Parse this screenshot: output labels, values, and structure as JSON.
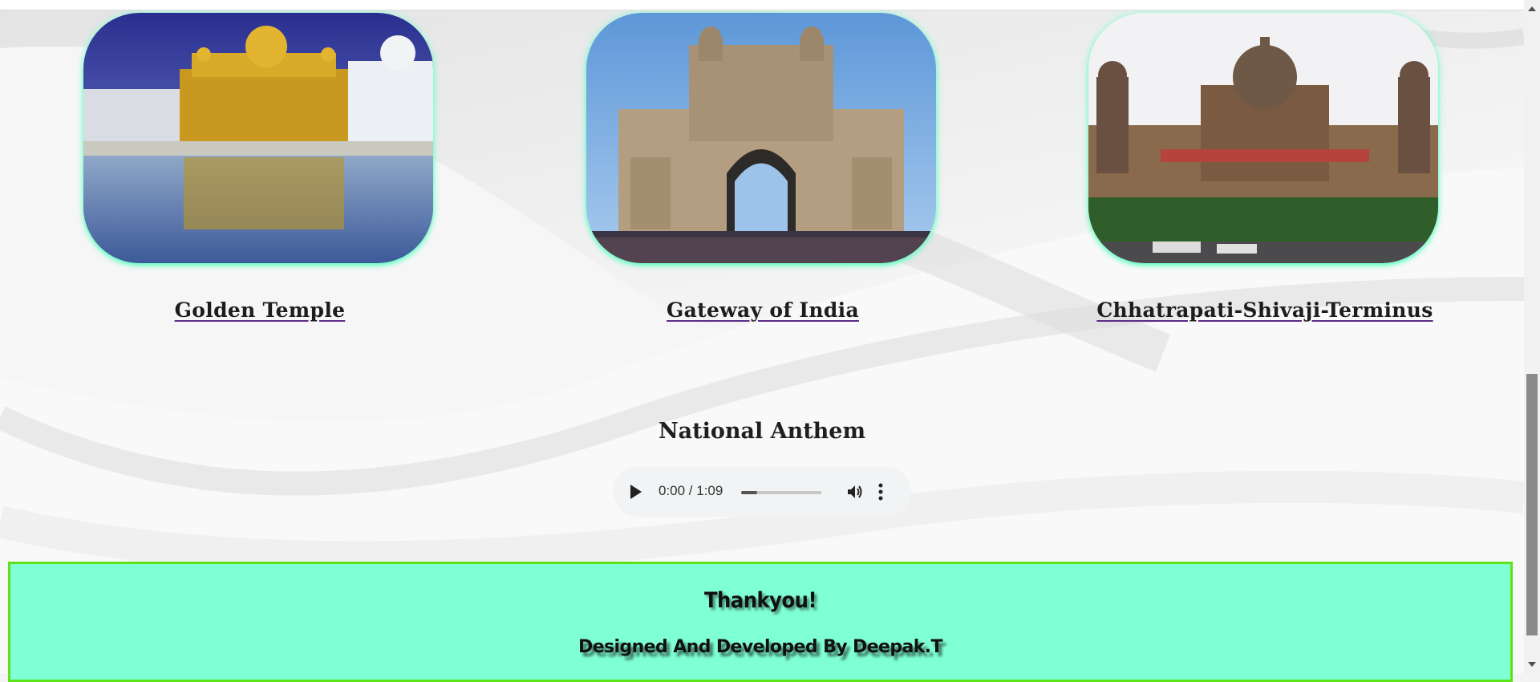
{
  "places": [
    {
      "name": "Golden Temple"
    },
    {
      "name": "Gateway of India"
    },
    {
      "name": "Chhatrapati-Shivaji-Terminus"
    }
  ],
  "anthem": {
    "title": "National Anthem",
    "time": "0:00 / 1:09",
    "progress": 0.2
  },
  "footer": {
    "thanks": "Thankyou!",
    "credit": "Designed And Developed By Deepak.T"
  },
  "colors": {
    "footer_bg": "#7fffd4",
    "footer_border": "#5de21a",
    "card_glow": "#7fffd4"
  }
}
